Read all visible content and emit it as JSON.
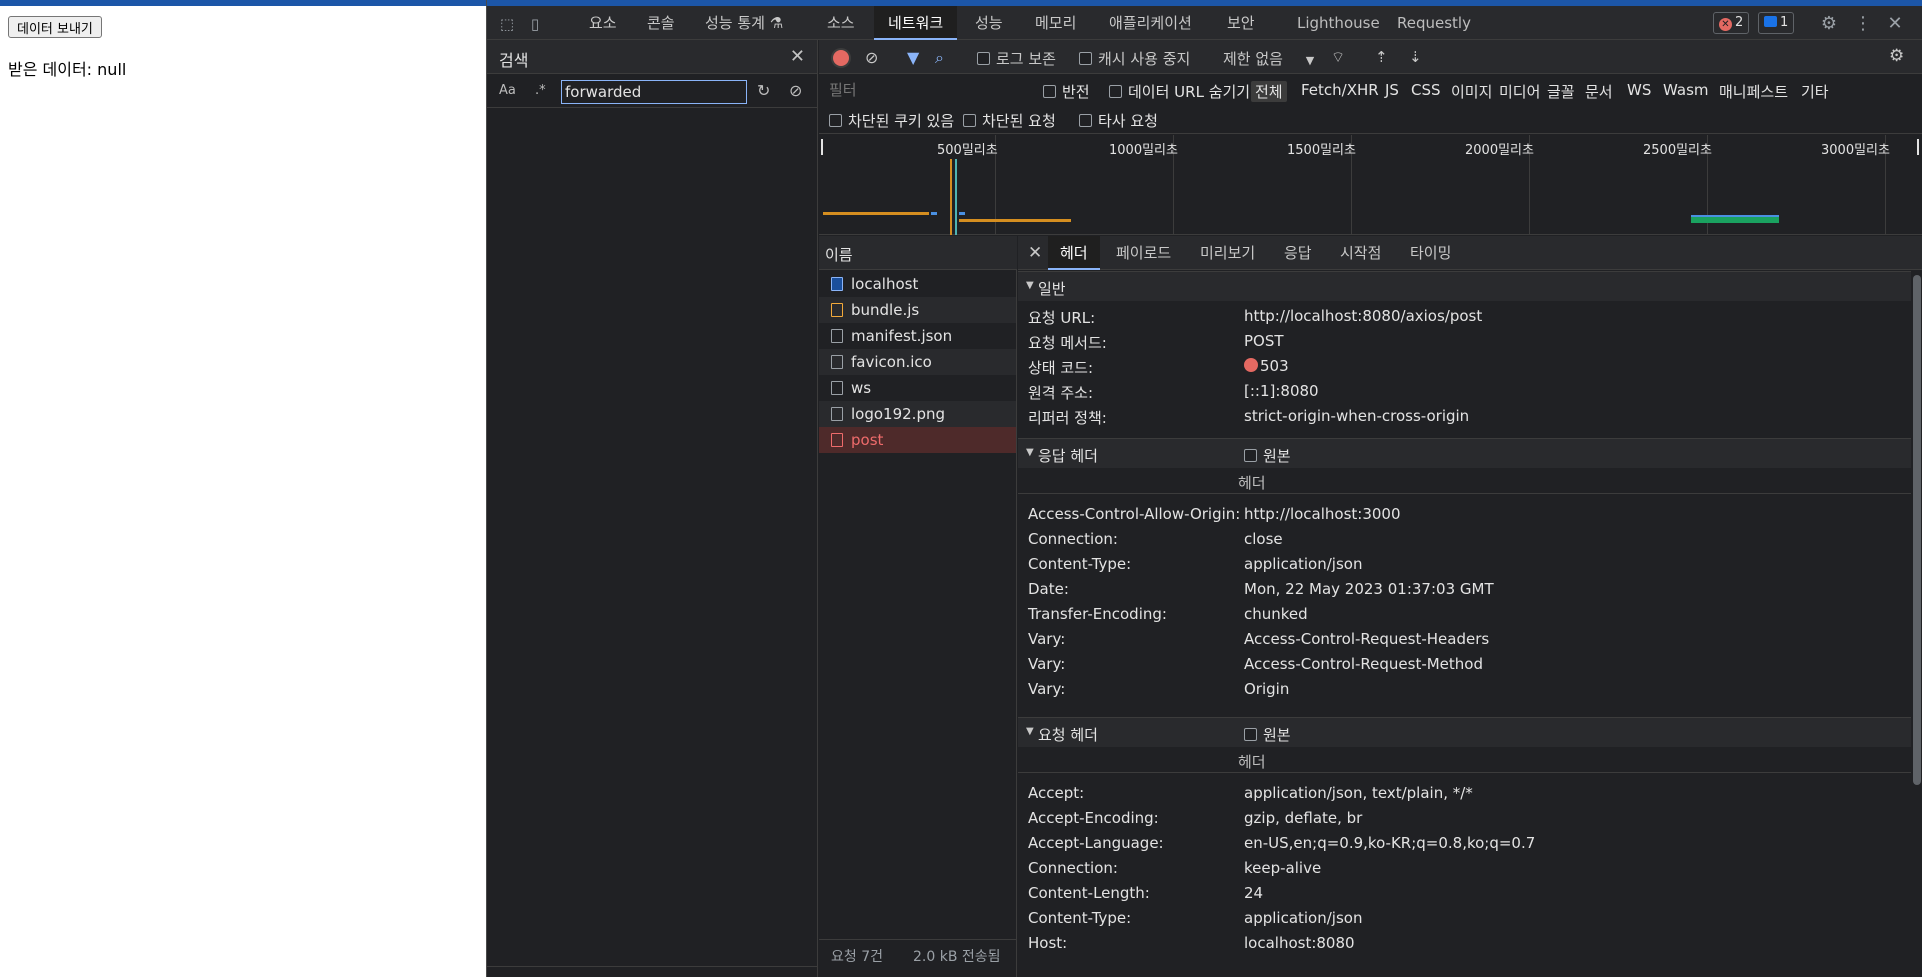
{
  "page": {
    "send_button": "데이터 보내기",
    "received_text": "받은 데이터: null"
  },
  "devtools": {
    "tabs": [
      "요소",
      "콘솔",
      "성능 통계",
      "소스",
      "네트워크",
      "성능",
      "메모리",
      "애플리케이션",
      "보안",
      "Lighthouse",
      "Requestly"
    ],
    "active_tab": "네트워크",
    "error_count": "2",
    "message_count": "1",
    "search": {
      "title": "검색",
      "case_label": "Aa",
      "regex_label": ".*",
      "query": "forwarded"
    },
    "toolbar": {
      "preserve_log": "로그 보존",
      "disable_cache": "캐시 사용 중지",
      "throttle": "제한 없음"
    },
    "filter": {
      "placeholder": "필터",
      "invert": "반전",
      "hide_data_urls": "데이터 URL 숨기기",
      "types": [
        "전체",
        "Fetch/XHR",
        "JS",
        "CSS",
        "이미지",
        "미디어",
        "글꼴",
        "문서",
        "WS",
        "Wasm",
        "매니페스트",
        "기타"
      ],
      "blocked_cookies": "차단된 쿠키 있음",
      "blocked_requests": "차단된 요청",
      "third_party": "타사 요청"
    },
    "timeline_labels": [
      "500밀리초",
      "1000밀리초",
      "1500밀리초",
      "2000밀리초",
      "2500밀리초",
      "3000밀리초"
    ],
    "requests": {
      "header": "이름",
      "items": [
        {
          "name": "localhost",
          "type": "doc"
        },
        {
          "name": "bundle.js",
          "type": "script"
        },
        {
          "name": "manifest.json",
          "type": "file"
        },
        {
          "name": "favicon.ico",
          "type": "file"
        },
        {
          "name": "ws",
          "type": "file"
        },
        {
          "name": "logo192.png",
          "type": "file"
        },
        {
          "name": "post",
          "type": "error"
        }
      ],
      "count": "요청 7건",
      "transferred": "2.0 kB 전송됨"
    },
    "details": {
      "tabs": [
        "헤더",
        "페이로드",
        "미리보기",
        "응답",
        "시작점",
        "타이밍"
      ],
      "active_tab": "헤더",
      "general_title": "일반",
      "general": [
        {
          "k": "요청 URL:",
          "v": "http://localhost:8080/axios/post"
        },
        {
          "k": "요청 메서드:",
          "v": "POST"
        },
        {
          "k": "상태 코드:",
          "v": "503"
        },
        {
          "k": "원격 주소:",
          "v": "[::1]:8080"
        },
        {
          "k": "리퍼러 정책:",
          "v": "strict-origin-when-cross-origin"
        }
      ],
      "response_title": "응답 헤더",
      "raw_label": "원본",
      "header_sub": "헤더",
      "response": [
        {
          "k": "Access-Control-Allow-Origin:",
          "v": "http://localhost:3000"
        },
        {
          "k": "Connection:",
          "v": "close"
        },
        {
          "k": "Content-Type:",
          "v": "application/json"
        },
        {
          "k": "Date:",
          "v": "Mon, 22 May 2023 01:37:03 GMT"
        },
        {
          "k": "Transfer-Encoding:",
          "v": "chunked"
        },
        {
          "k": "Vary:",
          "v": "Access-Control-Request-Headers"
        },
        {
          "k": "Vary:",
          "v": "Access-Control-Request-Method"
        },
        {
          "k": "Vary:",
          "v": "Origin"
        }
      ],
      "request_title": "요청 헤더",
      "request": [
        {
          "k": "Accept:",
          "v": "application/json, text/plain, */*"
        },
        {
          "k": "Accept-Encoding:",
          "v": "gzip, deflate, br"
        },
        {
          "k": "Accept-Language:",
          "v": "en-US,en;q=0.9,ko-KR;q=0.8,ko;q=0.7"
        },
        {
          "k": "Connection:",
          "v": "keep-alive"
        },
        {
          "k": "Content-Length:",
          "v": "24"
        },
        {
          "k": "Content-Type:",
          "v": "application/json"
        },
        {
          "k": "Host:",
          "v": "localhost:8080"
        }
      ]
    }
  }
}
